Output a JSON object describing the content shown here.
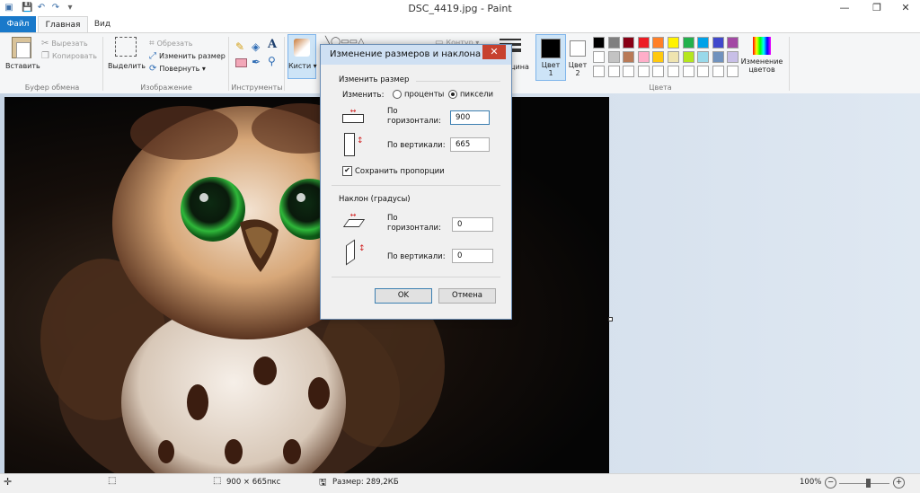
{
  "window": {
    "title": "DSC_4419.jpg - Paint",
    "minimize": "—",
    "maximize": "❐",
    "close": "✕"
  },
  "tabs": [
    {
      "label": "Файл"
    },
    {
      "label": "Главная"
    },
    {
      "label": "Вид"
    }
  ],
  "ribbon": {
    "clipboard": {
      "paste": "Вставить",
      "cut": "Вырезать",
      "copy": "Копировать",
      "group": "Буфер обмена"
    },
    "image": {
      "select": "Выделить",
      "crop": "Обрезать",
      "resize": "Изменить размер",
      "rotate": "Повернуть",
      "group": "Изображение"
    },
    "tools": {
      "group": "Инструменты",
      "text_tool": "A"
    },
    "brushes": {
      "label": "Кисти"
    },
    "shapes": {
      "outline": "Контур",
      "size": "щина"
    },
    "colors": {
      "color1": "Цвет",
      "color1_num": "1",
      "color2": "Цвет",
      "color2_num": "2",
      "edit_colors_line1": "Изменение",
      "edit_colors_line2": "цветов",
      "group": "Цвета",
      "row1": [
        "#000000",
        "#7f7f7f",
        "#880015",
        "#ed1c24",
        "#ff7f27",
        "#fff200",
        "#22b14c",
        "#00a2e8",
        "#3f48cc",
        "#a349a4"
      ],
      "row2": [
        "#ffffff",
        "#c3c3c3",
        "#b97a57",
        "#ffaec9",
        "#ffc90e",
        "#efe4b0",
        "#b5e61d",
        "#99d9ea",
        "#7092be",
        "#c8bfe7"
      ],
      "row3": [
        "#ffffff",
        "#ffffff",
        "#ffffff",
        "#ffffff",
        "#ffffff",
        "#ffffff",
        "#ffffff",
        "#ffffff",
        "#ffffff",
        "#ffffff"
      ]
    }
  },
  "dialog": {
    "title": "Изменение размеров и наклона",
    "close": "✕",
    "resize_section": "Изменить размер",
    "change_by": "Изменить:",
    "option_percent": "проценты",
    "option_pixels": "пиксели",
    "horiz_label_line1": "По",
    "horiz_label_line2": "горизонтали:",
    "vert_label": "По вертикали:",
    "width_value": "900",
    "height_value": "665",
    "keep_ratio": "Сохранить пропорции",
    "skew_section": "Наклон (градусы)",
    "skew_horiz_line1": "По",
    "skew_horiz_line2": "горизонтали:",
    "skew_vert_label": "По вертикали:",
    "skew_h_value": "0",
    "skew_v_value": "0",
    "ok": "OK",
    "cancel": "Отмена"
  },
  "status": {
    "dimensions": "900 × 665пкс",
    "size": "Размер: 289,2КБ",
    "zoom": "100%",
    "zoom_out": "−",
    "zoom_in": "+"
  }
}
